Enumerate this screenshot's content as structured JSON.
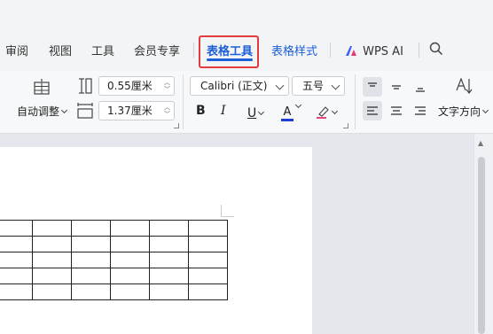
{
  "tabs": {
    "review": "审阅",
    "view": "视图",
    "tools": "工具",
    "member": "会员专享",
    "table_tools": "表格工具",
    "table_style": "表格样式",
    "wps_ai": "WPS AI"
  },
  "ribbon": {
    "autofit_label": "自动调整",
    "row_height": "0.55厘米",
    "col_width": "1.37厘米",
    "font_name": "Calibri (正文)",
    "font_size": "五号",
    "bold": "B",
    "italic": "I",
    "underline": "U",
    "font_color_letter": "A",
    "text_direction_label": "文字方向"
  },
  "colors": {
    "accent": "#1d5fd6",
    "highlight_box": "#e23b3b",
    "font_color_bar": "#1d3fd6"
  },
  "table": {
    "rows": 5,
    "cols": 6
  }
}
